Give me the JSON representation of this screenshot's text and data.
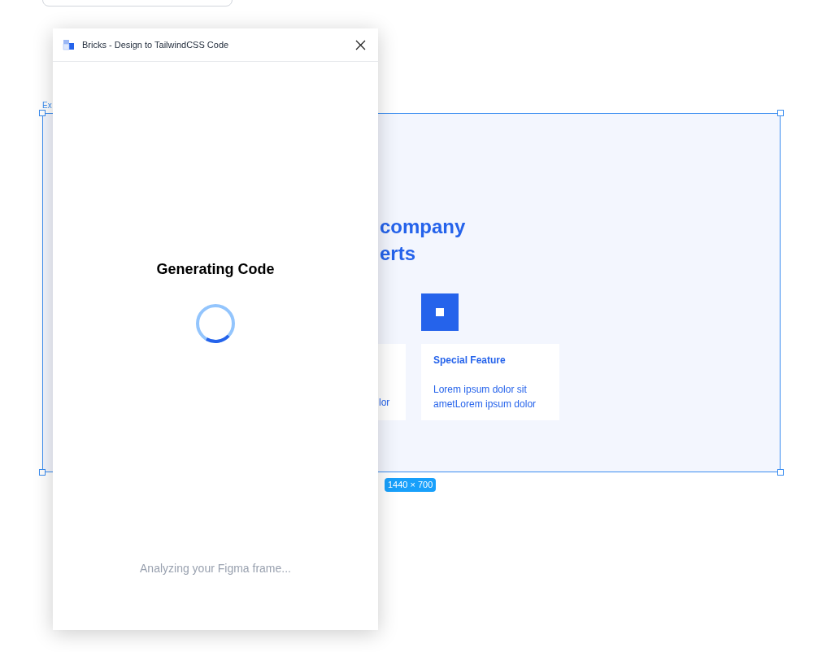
{
  "canvas": {
    "frame": {
      "label": "Ex",
      "size": "1440 × 700",
      "heading_lines": [
        "company",
        "erts"
      ],
      "cards": [
        {
          "kind": "partial",
          "text": "lor"
        },
        {
          "kind": "feature",
          "title": "Special Feature",
          "text": "Lorem ipsum dolor sit ametLorem ipsum dolor"
        }
      ]
    }
  },
  "plugin": {
    "title": "Bricks - Design to TailwindCSS Code",
    "status": "Generating Code",
    "message": "Analyzing your Figma frame..."
  }
}
